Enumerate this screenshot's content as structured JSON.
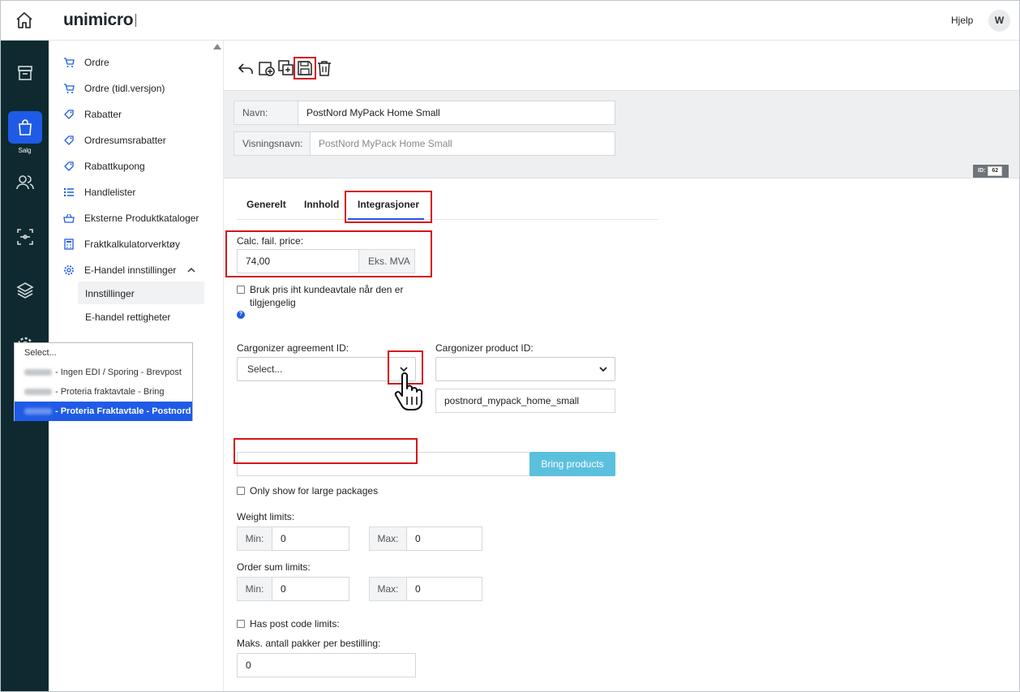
{
  "app": {
    "logo": "unimicro",
    "help": "Hjelp",
    "avatar": "W"
  },
  "rail": {
    "active_label": "Salg",
    "icons": [
      "home-icon",
      "archive-icon",
      "shopping-bag-icon",
      "users-icon",
      "scan-icon",
      "layers-icon",
      "gear-icon"
    ]
  },
  "menu": {
    "items": [
      {
        "label": "Ordre",
        "icon": "cart-icon"
      },
      {
        "label": "Ordre (tidl.versjon)",
        "icon": "cart-icon"
      },
      {
        "label": "Rabatter",
        "icon": "tag-icon"
      },
      {
        "label": "Ordresumsrabatter",
        "icon": "tag-icon"
      },
      {
        "label": "Rabattkupong",
        "icon": "tag-icon"
      },
      {
        "label": "Handlelister",
        "icon": "list-icon"
      },
      {
        "label": "Eksterne Produktkataloger",
        "icon": "basket-icon"
      },
      {
        "label": "Fraktkalkulatorverktøy",
        "icon": "calculator-icon"
      },
      {
        "label": "E-Handel innstillinger",
        "icon": "gear-icon"
      }
    ],
    "sub": [
      "Innstillinger",
      "E-handel rettigheter"
    ]
  },
  "header": {
    "name_label": "Navn:",
    "name_value": "PostNord MyPack Home Small",
    "display_label": "Visningsnavn:",
    "display_placeholder": "PostNord MyPack Home Small",
    "id_label": "ID:",
    "id_value": "62"
  },
  "tabs": [
    "Generelt",
    "Innhold",
    "Integrasjoner"
  ],
  "form": {
    "calc_label": "Calc. fail. price:",
    "calc_value": "74,00",
    "calc_suffix": "Eks. MVA",
    "use_price_label": "Bruk pris iht kundeavtale når den er",
    "use_price_label2": "tilgjengelig",
    "help": "?",
    "agreement_label": "Cargonizer agreement ID:",
    "agreement_value": "Select...",
    "product_label": "Cargonizer product ID:",
    "product_value": "",
    "product_code": "postnord_mypack_home_small",
    "dropdown": [
      "Select...",
      "- Ingen EDI / Sporing - Brevpost",
      "- Proteria fraktavtale - Bring",
      "- Proteria Fraktavtale - Postnord"
    ],
    "bring_button": "Bring products",
    "large_packages_label": "Only show for large packages",
    "weight_label": "Weight limits:",
    "order_sum_label": "Order sum limits:",
    "min_label": "Min:",
    "max_label": "Max:",
    "weight_min": "0",
    "weight_max": "0",
    "sum_min": "0",
    "sum_max": "0",
    "postcode_label": "Has post code limits:",
    "max_packages_label": "Maks. antall pakker per bestilling:",
    "max_packages_value": "0"
  }
}
